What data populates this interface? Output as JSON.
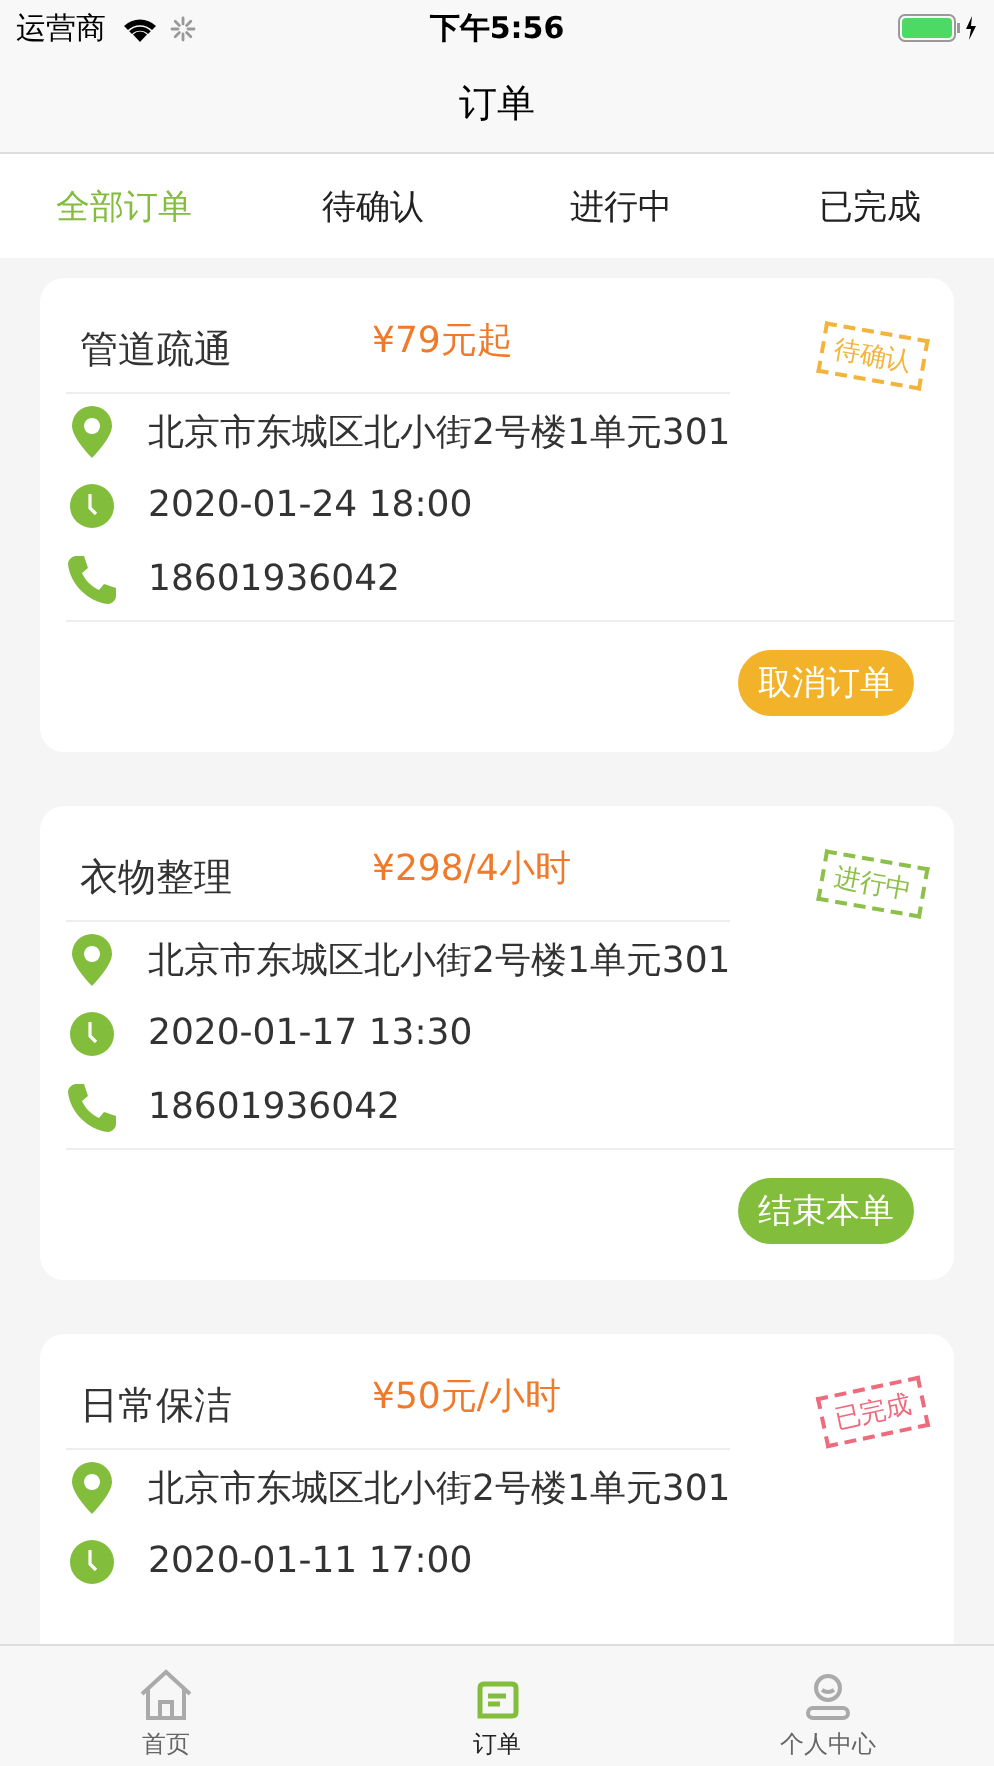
{
  "status_bar": {
    "carrier": "运营商",
    "time": "下午5:56"
  },
  "nav": {
    "title": "订单"
  },
  "tabs": [
    {
      "label": "全部订单",
      "selected": true
    },
    {
      "label": "待确认",
      "selected": false
    },
    {
      "label": "进行中",
      "selected": false
    },
    {
      "label": "已完成",
      "selected": false
    }
  ],
  "orders": [
    {
      "service": "管道疏通",
      "price": "¥79元起",
      "stamp": {
        "kind": "pending",
        "label": "待确认"
      },
      "address": "北京市东城区北小街2号楼1单元301",
      "time": "2020-01-24 18:00",
      "phone": "18601936042",
      "action": {
        "kind": "cancel",
        "label": "取消订单"
      }
    },
    {
      "service": "衣物整理",
      "price": "¥298/4小时",
      "stamp": {
        "kind": "ongoing",
        "label": "进行中"
      },
      "address": "北京市东城区北小街2号楼1单元301",
      "time": "2020-01-17 13:30",
      "phone": "18601936042",
      "action": {
        "kind": "finish",
        "label": "结束本单"
      }
    },
    {
      "service": "日常保洁",
      "price": "¥50元/小时",
      "stamp": {
        "kind": "done",
        "label": "已完成"
      },
      "address": "北京市东城区北小街2号楼1单元301",
      "time": "2020-01-11 17:00"
    }
  ],
  "bottom_nav": [
    {
      "kind": "home",
      "label": "首页",
      "selected": false
    },
    {
      "kind": "orders",
      "label": "订单",
      "selected": true
    },
    {
      "kind": "profile",
      "label": "个人中心",
      "selected": false
    }
  ]
}
